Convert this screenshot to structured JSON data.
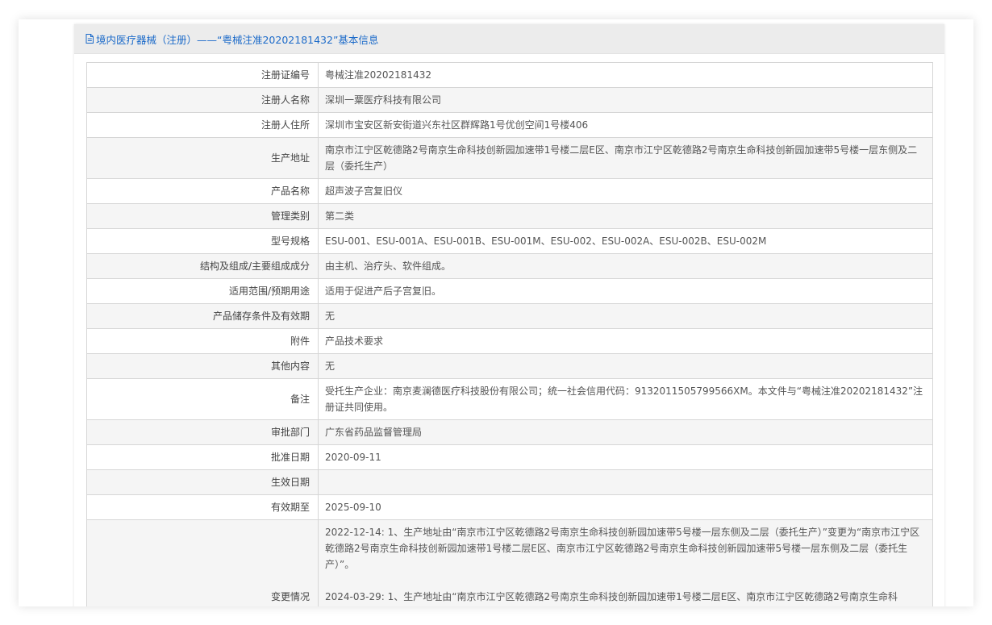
{
  "header": {
    "title": "境内医疗器械（注册）——“粤械注准20202181432”基本信息"
  },
  "rows": [
    {
      "label": "注册证编号",
      "value": "粤械注准20202181432"
    },
    {
      "label": "注册人名称",
      "value": "深圳一粟医疗科技有限公司"
    },
    {
      "label": "注册人住所",
      "value": "深圳市宝安区新安街道兴东社区群辉路1号优创空间1号楼406"
    },
    {
      "label": "生产地址",
      "value": "南京市江宁区乾德路2号南京生命科技创新园加速带1号楼二层E区、南京市江宁区乾德路2号南京生命科技创新园加速带5号楼一层东侧及二层（委托生产）"
    },
    {
      "label": "产品名称",
      "value": "超声波子宫复旧仪"
    },
    {
      "label": "管理类别",
      "value": "第二类"
    },
    {
      "label": "型号规格",
      "value": "ESU-001、ESU-001A、ESU-001B、ESU-001M、ESU-002、ESU-002A、ESU-002B、ESU-002M"
    },
    {
      "label": "结构及组成/主要组成成分",
      "value": "由主机、治疗头、软件组成。"
    },
    {
      "label": "适用范围/预期用途",
      "value": "适用于促进产后子宫复旧。"
    },
    {
      "label": "产品储存条件及有效期",
      "value": "无"
    },
    {
      "label": "附件",
      "value": "产品技术要求"
    },
    {
      "label": "其他内容",
      "value": "无"
    },
    {
      "label": "备注",
      "value": "受托生产企业：南京麦澜德医疗科技股份有限公司；统一社会信用代码：913201150579956­6XM。本文件与“粤械注准20202181432”注册证共同使用。"
    },
    {
      "label": "审批部门",
      "value": "广东省药品监督管理局"
    },
    {
      "label": "批准日期",
      "value": "2020-09-11"
    },
    {
      "label": "生效日期",
      "value": ""
    },
    {
      "label": "有效期至",
      "value": "2025-09-10"
    }
  ],
  "changes": {
    "label": "变更情况",
    "items": [
      "2022-12-14: 1、生产地址由“南京市江宁区乾德路2号南京生命科技创新园加速带5号楼一层东侧及二层（委托生产）”变更为“南京市江宁区乾德路2号南京生命科技创新园加速带1号楼二层E区、南京市江宁区乾德路2号南京生命科技创新园加速带5号楼一层东侧及二层（委托生产）”。",
      "2024-03-29: 1、生产地址由“南京市江宁区乾德路2号南京生命科技创新园加速带1号楼二层E区、南京市江宁区乾德路2号南京生命科"
    ]
  }
}
